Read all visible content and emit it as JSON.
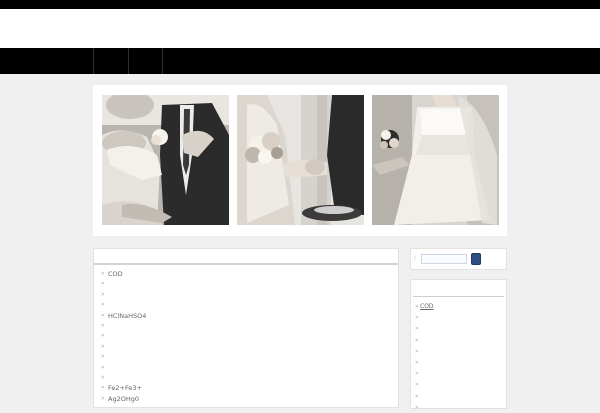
{
  "main_list": {
    "items": [
      "COD",
      "",
      "",
      "",
      "HClNaHSO4",
      "",
      "",
      "",
      "",
      "",
      "",
      "Fe2+Fe3+",
      "Ag2OHg0"
    ]
  },
  "search": {
    "label": ":",
    "placeholder": "",
    "button_label": ""
  },
  "sidebar": {
    "items": [
      "COD",
      "",
      "",
      "",
      "",
      "",
      "",
      "",
      "",
      ""
    ]
  },
  "colors": {
    "top_bar": "#000000",
    "nav_bar": "#000000",
    "page_bg": "#f0f0f0",
    "search_button": "#2c4e80"
  }
}
